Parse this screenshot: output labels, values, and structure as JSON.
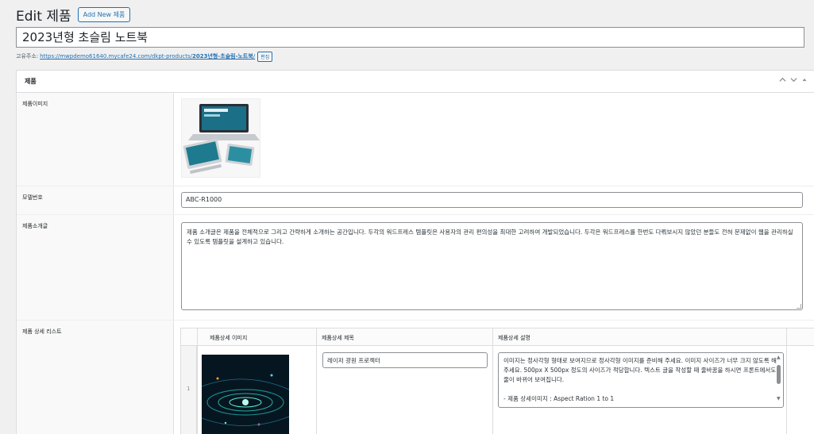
{
  "header": {
    "title": "Edit 제품",
    "add_new": "Add New 제품"
  },
  "post_title": "2023년형 초슬림 노트북",
  "permalink": {
    "label": "고유주소:",
    "url_base": "https://mwpdemo61640.mycafe24.com/dkpt-products/",
    "url_slug": "2023년형-초슬림-노트북",
    "url_trail": "/",
    "edit": "편집"
  },
  "metabox": {
    "title": "제품",
    "actions": {
      "up": "^",
      "down": "v",
      "toggle": "▲"
    },
    "fields": {
      "image_label": "제품이미지",
      "model_label": "모델번호",
      "model_value": "ABC-R1000",
      "intro_label": "제품소개글",
      "intro_value": "제품 소개글은 제품을 전체적으로 그리고 간략하게 소개하는 공간입니다. 두각의 워드프레스 템플릿은 사용자의 관리 편의성을 최대한 고려하여 개발되었습니다. 두각은 워드프레스를 한번도 다뤄보시지 않았던 분들도 전혀 문제없이 웹을 관리하실 수 있도록 템플릿을 설계하고 있습니다.",
      "detail_label": "제품 상세 리스트"
    },
    "repeater": {
      "columns": [
        "제품상세 이미지",
        "제품상세 제목",
        "제품상세 설명"
      ],
      "rows": [
        {
          "index": "1",
          "title": "레이저 광원 프로젝터",
          "description": "이미지는 정사각형 형태로 보여지므로 정사각형 이미지를 준비해 주세요. 이미지 사이즈가 너무 크지 않도록 해주세요. 500px X 500px 정도의 사이즈가 적당합니다. 텍스트 글을 작성할 때 줄바꿈을 하시면 프론트에서도 줄이 바뀌어 보여집니다.",
          "description_extra": "- 제품 상세이미지 : Aspect Ration 1 to 1"
        }
      ]
    }
  }
}
